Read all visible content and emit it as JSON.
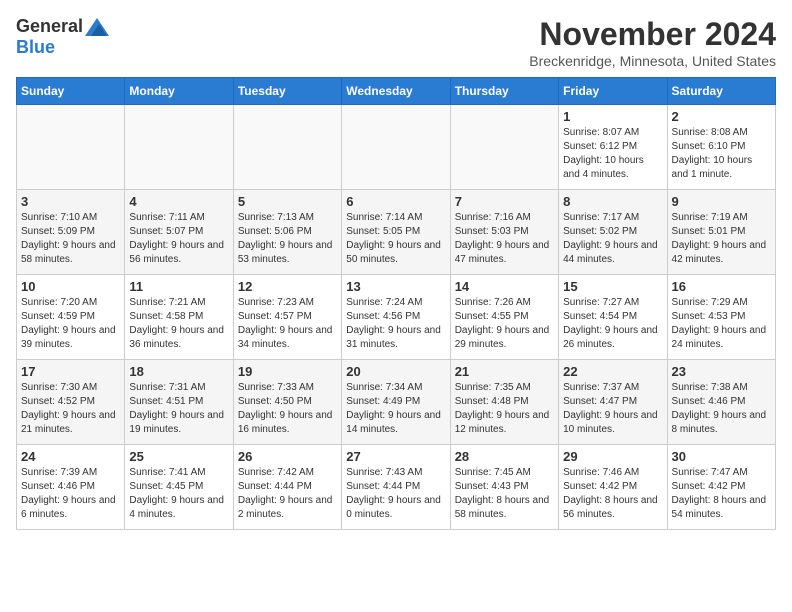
{
  "logo": {
    "general": "General",
    "blue": "Blue"
  },
  "title": "November 2024",
  "location": "Breckenridge, Minnesota, United States",
  "days_header": [
    "Sunday",
    "Monday",
    "Tuesday",
    "Wednesday",
    "Thursday",
    "Friday",
    "Saturday"
  ],
  "weeks": [
    [
      {
        "day": "",
        "info": ""
      },
      {
        "day": "",
        "info": ""
      },
      {
        "day": "",
        "info": ""
      },
      {
        "day": "",
        "info": ""
      },
      {
        "day": "",
        "info": ""
      },
      {
        "day": "1",
        "info": "Sunrise: 8:07 AM\nSunset: 6:12 PM\nDaylight: 10 hours and 4 minutes."
      },
      {
        "day": "2",
        "info": "Sunrise: 8:08 AM\nSunset: 6:10 PM\nDaylight: 10 hours and 1 minute."
      }
    ],
    [
      {
        "day": "3",
        "info": "Sunrise: 7:10 AM\nSunset: 5:09 PM\nDaylight: 9 hours and 58 minutes."
      },
      {
        "day": "4",
        "info": "Sunrise: 7:11 AM\nSunset: 5:07 PM\nDaylight: 9 hours and 56 minutes."
      },
      {
        "day": "5",
        "info": "Sunrise: 7:13 AM\nSunset: 5:06 PM\nDaylight: 9 hours and 53 minutes."
      },
      {
        "day": "6",
        "info": "Sunrise: 7:14 AM\nSunset: 5:05 PM\nDaylight: 9 hours and 50 minutes."
      },
      {
        "day": "7",
        "info": "Sunrise: 7:16 AM\nSunset: 5:03 PM\nDaylight: 9 hours and 47 minutes."
      },
      {
        "day": "8",
        "info": "Sunrise: 7:17 AM\nSunset: 5:02 PM\nDaylight: 9 hours and 44 minutes."
      },
      {
        "day": "9",
        "info": "Sunrise: 7:19 AM\nSunset: 5:01 PM\nDaylight: 9 hours and 42 minutes."
      }
    ],
    [
      {
        "day": "10",
        "info": "Sunrise: 7:20 AM\nSunset: 4:59 PM\nDaylight: 9 hours and 39 minutes."
      },
      {
        "day": "11",
        "info": "Sunrise: 7:21 AM\nSunset: 4:58 PM\nDaylight: 9 hours and 36 minutes."
      },
      {
        "day": "12",
        "info": "Sunrise: 7:23 AM\nSunset: 4:57 PM\nDaylight: 9 hours and 34 minutes."
      },
      {
        "day": "13",
        "info": "Sunrise: 7:24 AM\nSunset: 4:56 PM\nDaylight: 9 hours and 31 minutes."
      },
      {
        "day": "14",
        "info": "Sunrise: 7:26 AM\nSunset: 4:55 PM\nDaylight: 9 hours and 29 minutes."
      },
      {
        "day": "15",
        "info": "Sunrise: 7:27 AM\nSunset: 4:54 PM\nDaylight: 9 hours and 26 minutes."
      },
      {
        "day": "16",
        "info": "Sunrise: 7:29 AM\nSunset: 4:53 PM\nDaylight: 9 hours and 24 minutes."
      }
    ],
    [
      {
        "day": "17",
        "info": "Sunrise: 7:30 AM\nSunset: 4:52 PM\nDaylight: 9 hours and 21 minutes."
      },
      {
        "day": "18",
        "info": "Sunrise: 7:31 AM\nSunset: 4:51 PM\nDaylight: 9 hours and 19 minutes."
      },
      {
        "day": "19",
        "info": "Sunrise: 7:33 AM\nSunset: 4:50 PM\nDaylight: 9 hours and 16 minutes."
      },
      {
        "day": "20",
        "info": "Sunrise: 7:34 AM\nSunset: 4:49 PM\nDaylight: 9 hours and 14 minutes."
      },
      {
        "day": "21",
        "info": "Sunrise: 7:35 AM\nSunset: 4:48 PM\nDaylight: 9 hours and 12 minutes."
      },
      {
        "day": "22",
        "info": "Sunrise: 7:37 AM\nSunset: 4:47 PM\nDaylight: 9 hours and 10 minutes."
      },
      {
        "day": "23",
        "info": "Sunrise: 7:38 AM\nSunset: 4:46 PM\nDaylight: 9 hours and 8 minutes."
      }
    ],
    [
      {
        "day": "24",
        "info": "Sunrise: 7:39 AM\nSunset: 4:46 PM\nDaylight: 9 hours and 6 minutes."
      },
      {
        "day": "25",
        "info": "Sunrise: 7:41 AM\nSunset: 4:45 PM\nDaylight: 9 hours and 4 minutes."
      },
      {
        "day": "26",
        "info": "Sunrise: 7:42 AM\nSunset: 4:44 PM\nDaylight: 9 hours and 2 minutes."
      },
      {
        "day": "27",
        "info": "Sunrise: 7:43 AM\nSunset: 4:44 PM\nDaylight: 9 hours and 0 minutes."
      },
      {
        "day": "28",
        "info": "Sunrise: 7:45 AM\nSunset: 4:43 PM\nDaylight: 8 hours and 58 minutes."
      },
      {
        "day": "29",
        "info": "Sunrise: 7:46 AM\nSunset: 4:42 PM\nDaylight: 8 hours and 56 minutes."
      },
      {
        "day": "30",
        "info": "Sunrise: 7:47 AM\nSunset: 4:42 PM\nDaylight: 8 hours and 54 minutes."
      }
    ]
  ]
}
